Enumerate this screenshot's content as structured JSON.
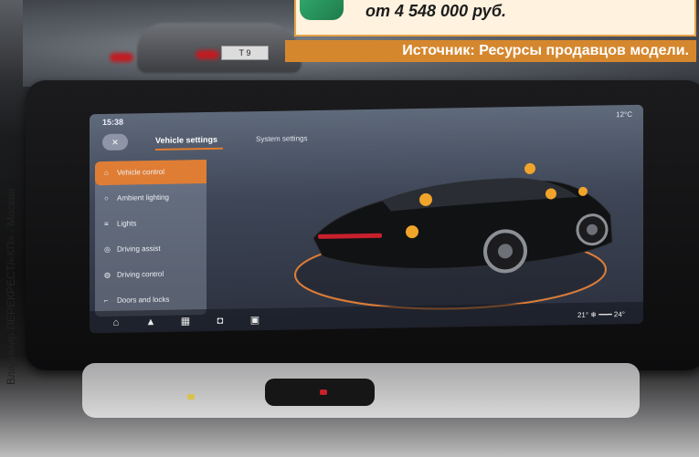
{
  "caption": {
    "price": "от 4 548 000 руб.",
    "source": "Источник: Ресурсы продавцов модели."
  },
  "photo_credit": "Владимир ПЕРЕКРЕСТ/«КП» - Москва",
  "background_plate": "Т 9",
  "screen": {
    "status_bar": {
      "time": "15:38",
      "temperature": "12°C"
    },
    "header": {
      "close_icon": "×",
      "tabs": [
        "Vehicle settings",
        "System settings"
      ],
      "active_tab": "Vehicle settings"
    },
    "menu": [
      {
        "label": "Vehicle control",
        "icon": "car-icon",
        "active": true
      },
      {
        "label": "Ambient lighting",
        "icon": "bulb-icon",
        "active": false
      },
      {
        "label": "Lights",
        "icon": "headlight-icon",
        "active": false
      },
      {
        "label": "Driving assist",
        "icon": "assist-icon",
        "active": false
      },
      {
        "label": "Driving control",
        "icon": "steering-icon",
        "active": false
      },
      {
        "label": "Doors and locks",
        "icon": "door-icon",
        "active": false
      }
    ],
    "dock": {
      "icons": [
        "home-icon",
        "warning-icon",
        "apps-icon",
        "car-icon",
        "media-icon"
      ],
      "right_text": "21°   ❄   ━━━   24°"
    }
  },
  "colors": {
    "accent_orange": "#e07d34",
    "source_bar": "#d5872e",
    "price_border": "#e7a34a"
  }
}
